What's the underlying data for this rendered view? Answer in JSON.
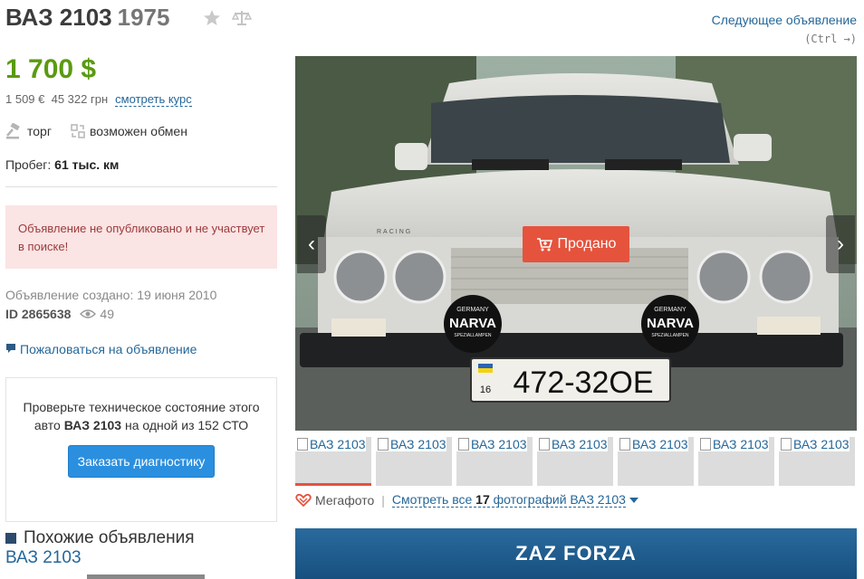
{
  "header": {
    "title": "ВАЗ 2103",
    "year": "1975",
    "next_link": "Следующее объявление",
    "next_hint": "(Ctrl →)"
  },
  "price": {
    "main": "1 700 $",
    "eur": "1 509 €",
    "uah": "45 322 грн",
    "rate_link": "смотреть курс"
  },
  "options": {
    "bargain": "торг",
    "exchange": "возможен обмен"
  },
  "mileage": {
    "label": "Пробег:",
    "value": "61 тыс. км"
  },
  "alert": {
    "text": "Объявление не опубликовано и не участвует в поиске!"
  },
  "meta": {
    "created": "Объявление создано: 19 июня 2010",
    "id_label": "ID",
    "id_value": "2865638",
    "views": "49"
  },
  "report_link": "Пожаловаться на объявление",
  "inspection": {
    "text_before": "Проверьте техническое состояние этого авто",
    "car": "ВАЗ 2103",
    "text_after": "на одной из 152 СТО",
    "button": "Заказать диагностику"
  },
  "similar": {
    "heading": "Похожие объявления",
    "link": "ВАЗ 2103"
  },
  "gallery": {
    "sold_label": "Продано",
    "plate": "472-32ОЕ",
    "plate_region": "16",
    "narva_brand": "NARVA",
    "narva_top": "GERMANY",
    "narva_bottom": "SPEZIALLAMPEN",
    "hood_badge": "RACING",
    "thumb_alt": "ВАЗ 2103",
    "thumbs_count": 7,
    "megafoto": "Мегафото",
    "see_all_prefix": "Смотреть все",
    "photos_count": "17",
    "see_all_suffix": "фотографий ВАЗ 2103"
  },
  "banner": {
    "text": "ZAZ FORZA"
  },
  "colors": {
    "price": "#5a9a11",
    "link": "#256799",
    "sold": "#e5533d",
    "button": "#2b8fdf",
    "alert_bg": "#fbe4e4"
  }
}
